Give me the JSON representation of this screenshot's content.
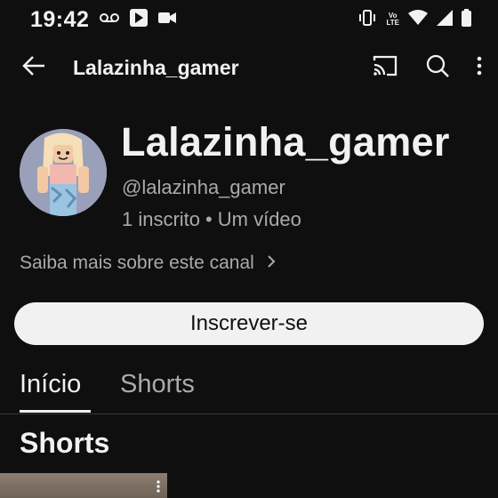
{
  "status_bar": {
    "time": "19:42",
    "volte_top": "Vo",
    "volte_bottom": "LTE"
  },
  "app_bar": {
    "title": "Lalazinha_gamer"
  },
  "channel": {
    "name": "Lalazinha_gamer",
    "handle": "@lalazinha_gamer",
    "subscribers": "1 inscrito",
    "separator": "•",
    "videos": "Um vídeo",
    "about_link": "Saiba mais sobre este canal",
    "subscribe_label": "Inscrever-se"
  },
  "tabs": [
    {
      "label": "Início",
      "active": true
    },
    {
      "label": "Shorts",
      "active": false
    }
  ],
  "section": {
    "title": "Shorts"
  },
  "colors": {
    "background": "#0f0f0f",
    "text": "#f1f1f1",
    "secondary_text": "#aaaaaa",
    "button_bg": "#f1f1f1"
  }
}
